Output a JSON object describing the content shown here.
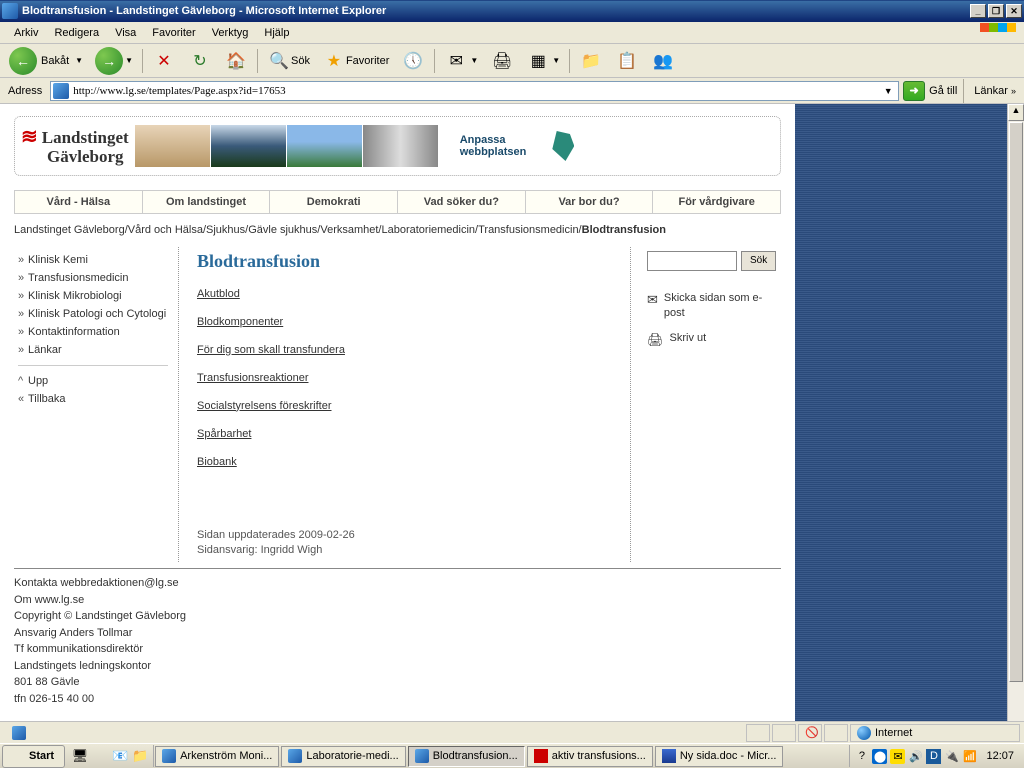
{
  "window": {
    "title": "Blodtransfusion - Landstinget Gävleborg - Microsoft Internet Explorer"
  },
  "menu": {
    "items": [
      "Arkiv",
      "Redigera",
      "Visa",
      "Favoriter",
      "Verktyg",
      "Hjälp"
    ]
  },
  "toolbar": {
    "back": "Bakåt",
    "search": "Sök",
    "favorites": "Favoriter"
  },
  "address": {
    "label": "Adress",
    "url": "http://www.lg.se/templates/Page.aspx?id=17653",
    "go": "Gå till",
    "links": "Länkar"
  },
  "logo": {
    "line1": "Landstinget",
    "line2": "Gävleborg"
  },
  "anpassa": {
    "line1": "Anpassa",
    "line2": "webbplatsen"
  },
  "tabs": [
    "Vård - Hälsa",
    "Om landstinget",
    "Demokrati",
    "Vad söker du?",
    "Var bor du?",
    "För vårdgivare"
  ],
  "breadcrumb": {
    "path": "Landstinget Gävleborg/Vård och Hälsa/Sjukhus/Gävle sjukhus/Verksamhet/Laboratoriemedicin/Transfusionsmedicin/",
    "current": "Blodtransfusion"
  },
  "leftnav": {
    "items": [
      "Klinisk Kemi",
      "Transfusionsmedicin",
      "Klinisk Mikrobiologi",
      "Klinisk Patologi och Cytologi",
      "Kontaktinformation",
      "Länkar"
    ],
    "up": "Upp",
    "back": "Tillbaka"
  },
  "content": {
    "heading": "Blodtransfusion",
    "links": [
      "Akutblod",
      "Blodkomponenter",
      "För dig som skall transfundera",
      "Transfusionsreaktioner",
      "Socialstyrelsens föreskrifter",
      "Spårbarhet",
      "Biobank"
    ],
    "updated": "Sidan uppdaterades 2009-02-26",
    "responsible": "Sidansvarig: Ingridd Wigh"
  },
  "rightcol": {
    "search_btn": "Sök",
    "send": "Skicka sidan som e-post",
    "print": "Skriv ut"
  },
  "footer": {
    "kontakta_label": "Kontakta ",
    "kontakta_link": "webbredaktionen@lg.se",
    "om_label": "Om ",
    "om_link": "www.lg.se",
    "copyright": "Copyright © Landstinget Gävleborg",
    "ansvarig": "Ansvarig Anders Tollmar",
    "role": "Tf kommunikationsdirektör",
    "org": "Landstingets ledningskontor",
    "addr": "801 88 Gävle",
    "tfn": "tfn 026-15 40 00"
  },
  "status": {
    "zone": "Internet"
  },
  "taskbar": {
    "start": "Start",
    "tasks": [
      {
        "label": "Arkenström Moni...",
        "icon": "ie"
      },
      {
        "label": "Laboratorie-medi...",
        "icon": "ie"
      },
      {
        "label": "Blodtransfusion...",
        "icon": "ie",
        "active": true
      },
      {
        "label": "aktiv transfusions...",
        "icon": "pdf"
      },
      {
        "label": "Ny sida.doc - Micr...",
        "icon": "word"
      }
    ],
    "clock": "12:07"
  }
}
